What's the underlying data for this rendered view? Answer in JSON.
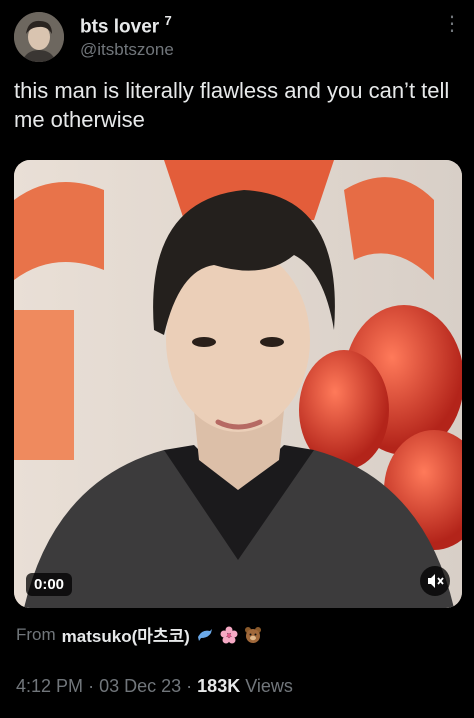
{
  "author": {
    "display_name": "bts lover",
    "badge": "7",
    "handle": "@itsbtszone"
  },
  "tweet": {
    "text": "this man is literally flawless and you can’t tell me otherwise"
  },
  "video": {
    "time": "0:00",
    "mute_icon": "speaker-muted-icon"
  },
  "source": {
    "prefix": "From",
    "name": "matsuko(마츠코)"
  },
  "meta": {
    "time": "4:12 PM",
    "sep1": "·",
    "date": "03 Dec 23",
    "sep2": "·",
    "views_count": "183K",
    "views_label": "Views"
  },
  "colors": {
    "background": "#000000",
    "text": "#e7e9ea",
    "muted": "#71767b"
  }
}
